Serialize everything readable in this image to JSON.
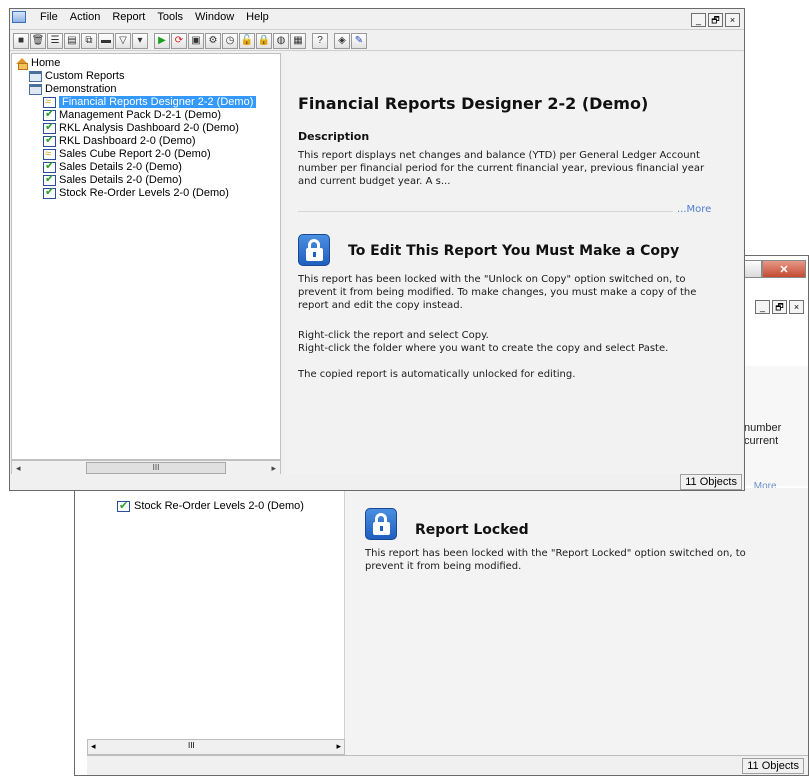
{
  "menu": {
    "file": "File",
    "action": "Action",
    "report": "Report",
    "tools": "Tools",
    "window": "Window",
    "help": "Help"
  },
  "mdi": {
    "minimize": "_",
    "restore": "🗗",
    "close": "×"
  },
  "tree": {
    "home": "Home",
    "custom_reports": "Custom Reports",
    "demonstration": "Demonstration",
    "items": [
      "Financial Reports Designer 2-2 (Demo)",
      "Management Pack D-2-1 (Demo)",
      "RKL Analysis Dashboard 2-0 (Demo)",
      "RKL Dashboard 2-0 (Demo)",
      "Sales Cube Report 2-0 (Demo)",
      "Sales Details 2-0 (Demo)",
      "Sales Details 2-0 (Demo)",
      "Stock Re-Order Levels 2-0 (Demo)"
    ],
    "scroll_thumb": "III"
  },
  "detail": {
    "title": "Financial Reports Designer 2-2 (Demo)",
    "desc_heading": "Description",
    "desc_text": "This report displays net changes and balance (YTD) per General Ledger Account number per financial period for the current financial year, previous financial year and current budget year. A s...",
    "more": "...More",
    "lock_heading": "To Edit This Report You Must Make a Copy",
    "lock_p1": "This report has been locked with the \"Unlock on Copy\" option switched on, to prevent it from being modified. To make changes, you must make a copy of the report and edit the copy instead.",
    "lock_p2a": "Right-click the report and select Copy.",
    "lock_p2b": "Right-click the folder where you want to create the copy and select Paste.",
    "lock_p3": "The copied report is automatically unlocked for editing."
  },
  "status": {
    "count": "11 Objects"
  },
  "back": {
    "tree_item": "Stock Re-Order Levels 2-0 (Demo)",
    "desc_frag_1": "number",
    "desc_frag_2": "current",
    "more": ".More",
    "lock_heading": "Report Locked",
    "lock_text": "This report has been locked with the \"Report Locked\" option switched on, to prevent it from being modified.",
    "status_count": "11 Objects",
    "scroll_thumb": "III"
  }
}
